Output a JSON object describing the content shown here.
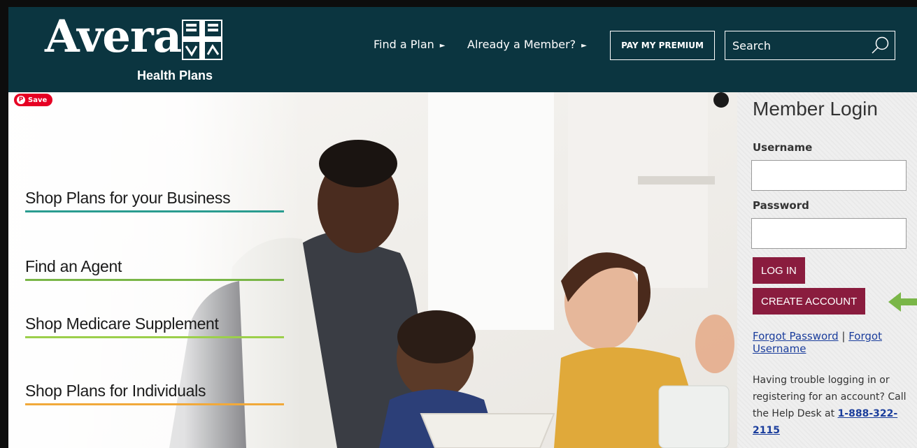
{
  "header": {
    "logo_word": "Avera",
    "logo_subtitle": "Health Plans",
    "nav_find_plan": "Find a Plan",
    "nav_member": "Already a Member?",
    "nav_arrow": "►",
    "pay_button": "PAY MY PREMIUM",
    "search_label": "Search"
  },
  "hero": {
    "save_label": "Save",
    "links": {
      "business": "Shop Plans for your Business",
      "agent": "Find an Agent",
      "medicare": "Shop Medicare Supplement",
      "individuals": "Shop Plans for Individuals"
    }
  },
  "login": {
    "title": "Member Login",
    "username_label": "Username",
    "password_label": "Password",
    "login_button": "LOG IN",
    "create_button": "CREATE ACCOUNT",
    "forgot_password": "Forgot Password",
    "separator": "|",
    "forgot_username": "Forgot Username",
    "help_text": "Having trouble logging in or registering for an account? Call the Help Desk at",
    "help_phone": "1-888-322-2115"
  },
  "colors": {
    "header_bg": "#0b3540",
    "button_maroon": "#8a1c3e",
    "arrow_green": "#7ab648",
    "link_blue": "#1a3d9c"
  }
}
